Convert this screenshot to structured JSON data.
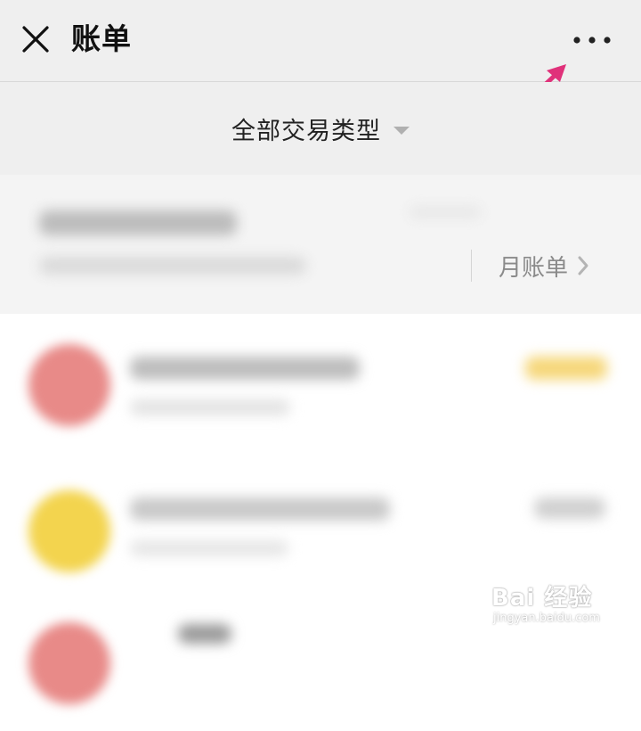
{
  "header": {
    "title": "账单",
    "close_icon": "close-icon",
    "more_icon": "more-dots-icon"
  },
  "filter": {
    "label": "全部交易类型",
    "caret_icon": "caret-down-icon"
  },
  "summary": {
    "monthly_bill_label": "月账单",
    "chevron_icon": "chevron-right-icon"
  },
  "list": {
    "rows": [
      {
        "avatar_color": "#e88a88",
        "amount_color": "#f6d77a"
      },
      {
        "avatar_color": "#f3d44e",
        "amount_color": "#c8c8c8"
      },
      {
        "avatar_color": "#e88a88"
      }
    ]
  },
  "annotation": {
    "arrow_color": "#e0317a"
  },
  "watermark": {
    "main": "Bai 经验",
    "sub": "jingyan.baidu.com"
  }
}
